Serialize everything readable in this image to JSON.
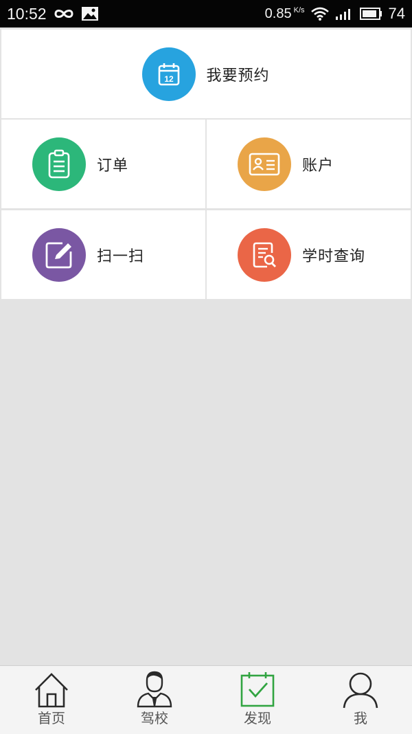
{
  "status_bar": {
    "time": "10:52",
    "speed": "0.85",
    "speed_unit": "K/s",
    "battery": "74"
  },
  "colors": {
    "reserve": "#27a3df",
    "orders": "#2cb77a",
    "account": "#e9a548",
    "scan": "#7a57a3",
    "hours": "#ea6647",
    "active_tab": "#31a441"
  },
  "menu": {
    "reserve": {
      "label": "我要预约",
      "icon": "calendar-icon",
      "day": "12"
    },
    "orders": {
      "label": "订单",
      "icon": "clipboard-icon"
    },
    "account": {
      "label": "账户",
      "icon": "id-card-icon"
    },
    "scan": {
      "label": "扫一扫",
      "icon": "edit-icon"
    },
    "hours": {
      "label": "学时查询",
      "icon": "document-search-icon"
    }
  },
  "tabbar": {
    "items": [
      {
        "label": "首页",
        "icon": "home-icon"
      },
      {
        "label": "驾校",
        "icon": "instructor-icon"
      },
      {
        "label": "发现",
        "icon": "calendar-check-icon",
        "active": true
      },
      {
        "label": "我",
        "icon": "user-icon"
      }
    ]
  }
}
